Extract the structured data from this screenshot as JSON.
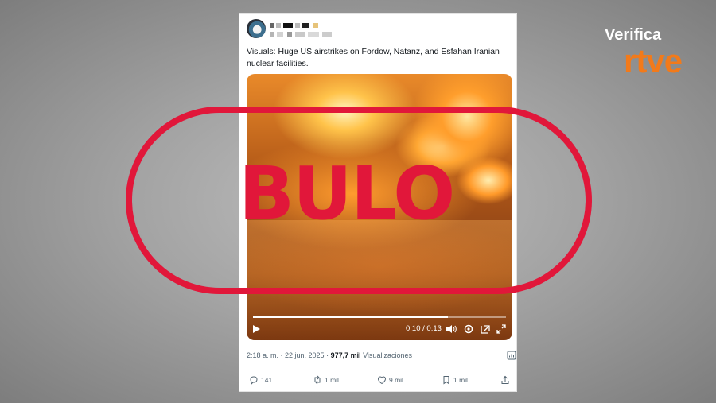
{
  "brand": {
    "top": "Verifica",
    "bottom": "rtve",
    "color": "#f27a1a"
  },
  "stamp": {
    "label": "BULO",
    "color": "#e1173a"
  },
  "tweet": {
    "text": "Visuals: Huge US airstrikes on Fordow, Natanz, and Esfahan Iranian nuclear facilities.",
    "video": {
      "time": "0:10 / 0:13",
      "progress_fraction": 0.77
    },
    "meta": {
      "time_date": "2:18 a. m. · 22 jun. 2025 · ",
      "views_count": "977,7 mil",
      "views_label": " Visualizaciones"
    },
    "actions": {
      "replies": "141",
      "retweets": "1 mil",
      "likes": "9 mil",
      "bookmarks": "1 mil"
    }
  }
}
